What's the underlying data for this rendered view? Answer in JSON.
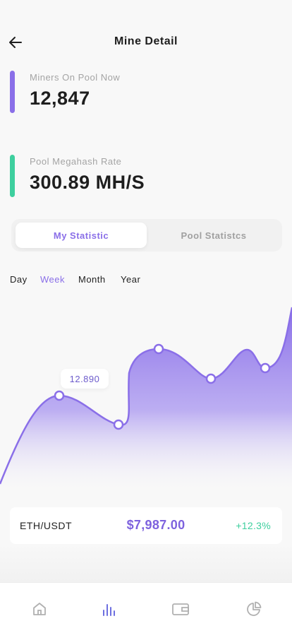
{
  "header": {
    "title": "Mine Detail"
  },
  "stats": [
    {
      "label": "Miners On Pool Now",
      "value": "12,847",
      "color": "#8a6fe8"
    },
    {
      "label": "Pool Megahash Rate",
      "value": "300.89 MH/S",
      "color": "#3ecf9e"
    }
  ],
  "tabs": [
    {
      "label": "My Statistic",
      "active": true
    },
    {
      "label": "Pool Statistcs",
      "active": false
    }
  ],
  "periods": [
    {
      "label": "Day",
      "active": false
    },
    {
      "label": "Week",
      "active": true
    },
    {
      "label": "Month",
      "active": false
    },
    {
      "label": "Year",
      "active": false
    }
  ],
  "chart_data": {
    "type": "area",
    "highlighted_value": "12.890",
    "fill_color": "#8a6fe8",
    "grid": false,
    "legend": "none"
  },
  "price": {
    "pair": "ETH/USDT",
    "value": "$7,987.00",
    "change": "+12.3%"
  },
  "nav": [
    {
      "icon": "home-icon",
      "active": false
    },
    {
      "icon": "bar-chart-icon",
      "active": true
    },
    {
      "icon": "wallet-icon",
      "active": false
    },
    {
      "icon": "pie-chart-icon",
      "active": false
    }
  ],
  "colors": {
    "accent": "#8a6fe8",
    "positive": "#3ecf9e",
    "background": "#f8f8f8"
  }
}
